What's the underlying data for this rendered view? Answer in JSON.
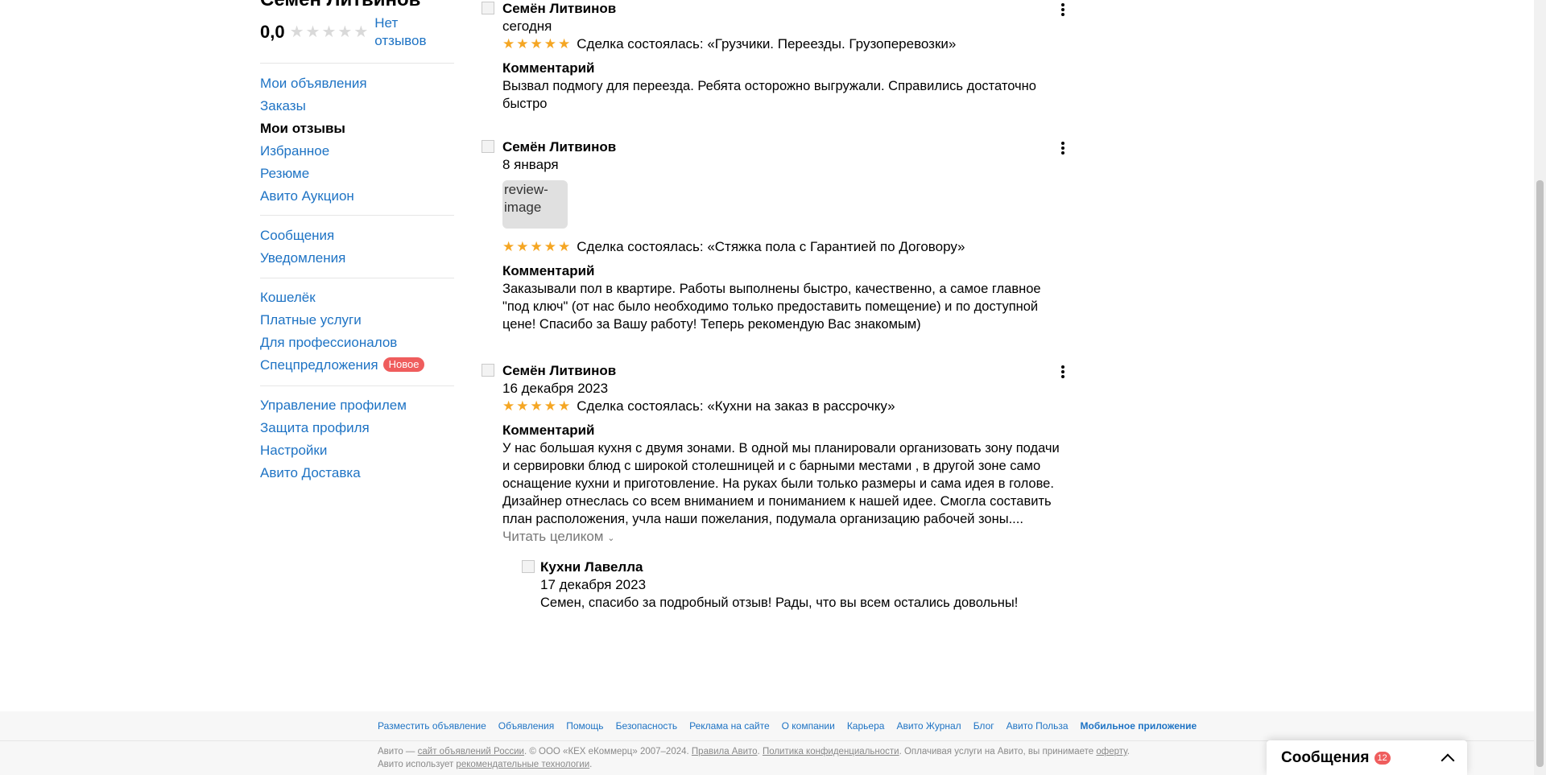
{
  "profile": {
    "name": "Семён Литвинов",
    "rating_value": "0,0",
    "no_reviews": "Нет отзывов"
  },
  "sidebar": {
    "group1": [
      {
        "label": "Мои объявления",
        "active": false
      },
      {
        "label": "Заказы",
        "active": false
      },
      {
        "label": "Мои отзывы",
        "active": true
      },
      {
        "label": "Избранное",
        "active": false
      },
      {
        "label": "Резюме",
        "active": false
      },
      {
        "label": "Авито Аукцион",
        "active": false
      }
    ],
    "group2": [
      {
        "label": "Сообщения"
      },
      {
        "label": "Уведомления"
      }
    ],
    "group3": [
      {
        "label": "Кошелёк"
      },
      {
        "label": "Платные услуги"
      },
      {
        "label": "Для профессионалов"
      },
      {
        "label": "Спецпредложения",
        "badge": "Новое"
      }
    ],
    "group4": [
      {
        "label": "Управление профилем"
      },
      {
        "label": "Защита профиля"
      },
      {
        "label": "Настройки"
      },
      {
        "label": "Авито Доставка"
      }
    ]
  },
  "reviews": [
    {
      "author": "Семён Литвинов",
      "date": "сегодня",
      "rating": 5,
      "deal": "Сделка состоялась: «Грузчики. Переезды. Грузоперевозки»",
      "comment_label": "Комментарий",
      "comment": "Вызвал подмогу для переезда. Ребята осторожно выгружали. Справились достаточно быстро"
    },
    {
      "author": "Семён Литвинов",
      "date": "8 января",
      "image_alt": "review-image",
      "rating": 5,
      "deal": "Сделка состоялась: «Стяжка пола с Гарантией по Договору»",
      "comment_label": "Комментарий",
      "comment": "Заказывали пол в квартире. Работы выполнены быстро, качественно, а самое главное \"под ключ\" (от нас было необходимо только предоставить помещение) и по доступной цене! Спасибо за Вашу работу! Теперь рекомендую Вас знакомым)"
    },
    {
      "author": "Семён Литвинов",
      "date": "16 декабря 2023",
      "rating": 5,
      "deal": "Сделка состоялась: «Кухни на заказ в рассрочку»",
      "comment_label": "Комментарий",
      "comment": "У нас большая кухня с двумя зонами. В одной мы планировали организовать зону подачи и сервировки блюд с широкой столешницей и с барными местами , в другой зоне само оснащение кухни и приготовление. На руках были только размеры и сама идея в голове. Дизайнер отнеслась со всем вниманием и пониманием к нашей идее. Смогла составить план расположения, учла наши пожелания, подумала организацию рабочей зоны....",
      "read_more": "Читать целиком",
      "reply": {
        "author": "Кухни Лавелла",
        "date": "17 декабря 2023",
        "text": "Семен, спасибо за подробный отзыв! Рады, что вы всем остались довольны!"
      }
    }
  ],
  "footer": {
    "links": [
      "Разместить объявление",
      "Объявления",
      "Помощь",
      "Безопасность",
      "Реклама на сайте",
      "О компании",
      "Карьера",
      "Авито Журнал",
      "Блог",
      "Авито Польза",
      "Мобильное приложение"
    ],
    "legal": {
      "t1": "Авито — ",
      "l1": "сайт объявлений России",
      "t2": ". © ООО «КЕХ еКоммерц» 2007–2024. ",
      "l2": "Правила Авито",
      "t3": ". ",
      "l3": "Политика конфиденциальности",
      "t4": ". Оплачивая услуги на Авито, вы принимаете ",
      "l4": "оферту",
      "t5": ". Авито использует ",
      "l5": "рекомендательные технологии",
      "t6": "."
    }
  },
  "messages_widget": {
    "title": "Сообщения",
    "count": "12"
  },
  "colors": {
    "link": "#1e73c4",
    "star": "#f5a623",
    "badge": "#ef5d5d"
  },
  "icons": {
    "star": "star-icon",
    "menu": "more-vertical-icon",
    "chevron": "chevron-up-icon"
  }
}
